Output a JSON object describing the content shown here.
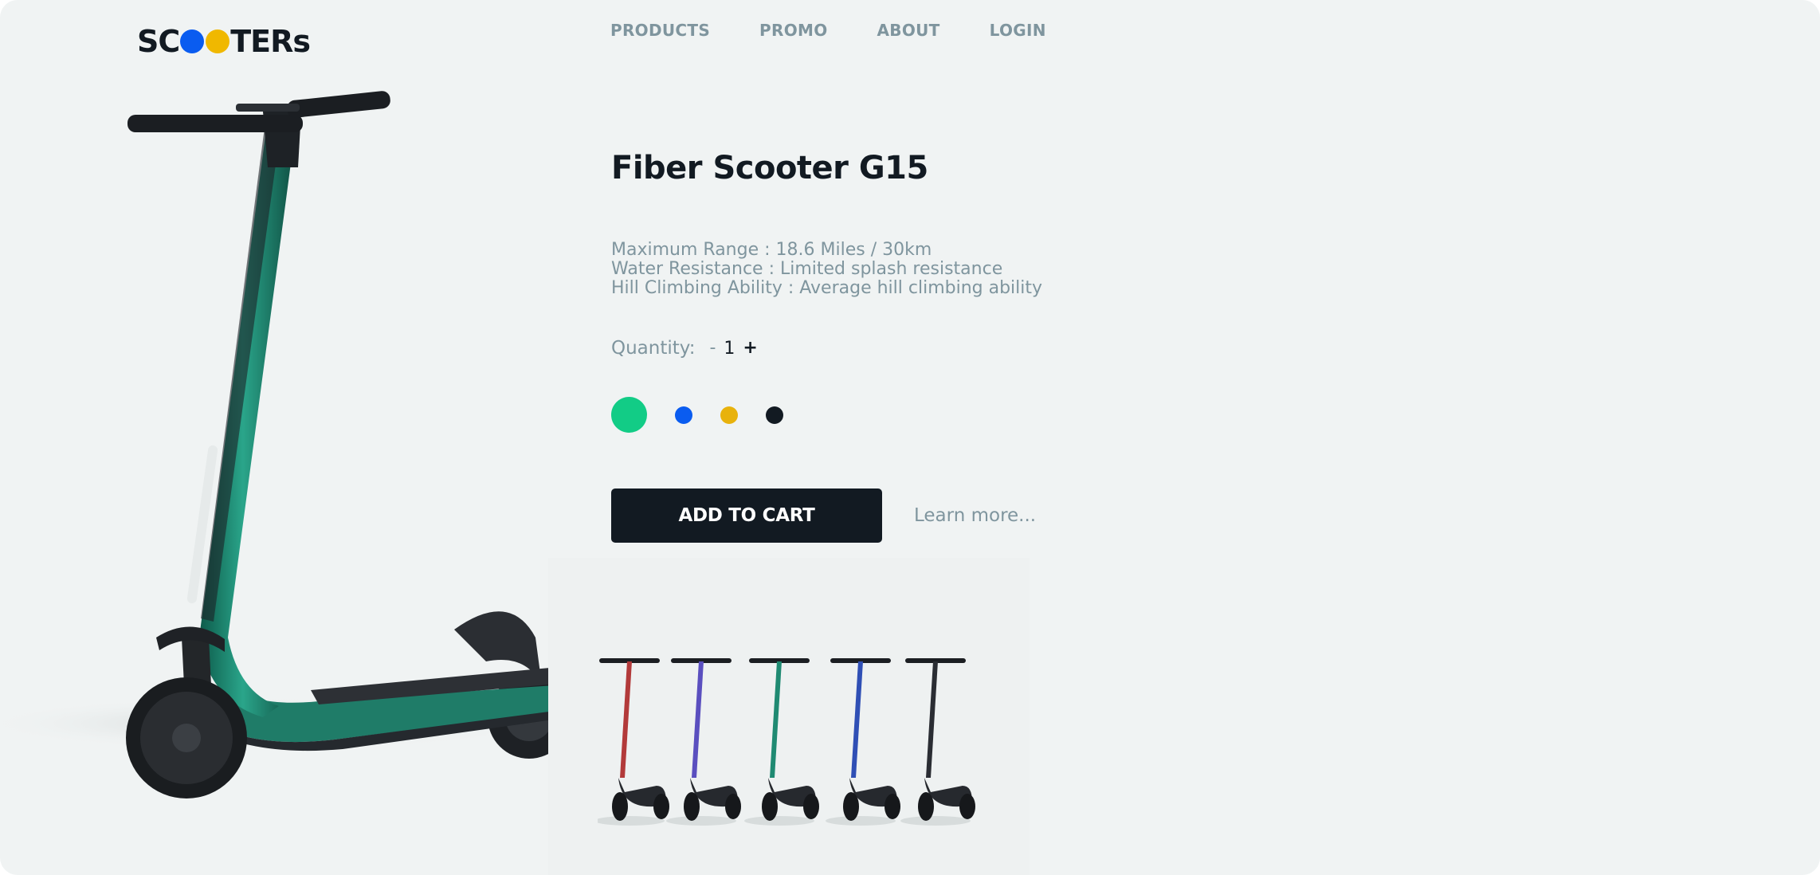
{
  "brand": {
    "logo_prefix": "SC",
    "logo_suffix": "TERs",
    "dot_colors": [
      "#0a5cf0",
      "#f0b800"
    ]
  },
  "nav": {
    "items": [
      {
        "label": "PRODUCTS"
      },
      {
        "label": "PROMO"
      },
      {
        "label": "ABOUT"
      },
      {
        "label": "LOGIN"
      }
    ]
  },
  "product": {
    "title": "Fiber Scooter G15",
    "specs": [
      "Maximum Range : 18.6 Miles / 30km",
      "Water Resistance : Limited splash resistance",
      "Hill Climbing Ability : Average hill climbing ability"
    ],
    "quantity": {
      "label": "Quantity:",
      "minus": "-",
      "value": "1",
      "plus": "+"
    },
    "colors": [
      {
        "name": "green",
        "hex": "#12cc86",
        "selected": true
      },
      {
        "name": "blue",
        "hex": "#0a5cf0",
        "selected": false
      },
      {
        "name": "yellow",
        "hex": "#e8b20c",
        "selected": false
      },
      {
        "name": "black",
        "hex": "#121a22",
        "selected": false
      }
    ],
    "add_to_cart_label": "ADD TO CART",
    "learn_more_label": "Learn more..."
  },
  "theme": {
    "background": "#f0f3f3",
    "text_dark": "#121a22",
    "text_muted": "#7f959e",
    "scooter_accent": "#1f8a72"
  },
  "lineup": {
    "accent_colors": [
      "#b23a3a",
      "#5a4fbf",
      "#1f8a72",
      "#2f4fb5",
      "#2a2d33"
    ]
  }
}
